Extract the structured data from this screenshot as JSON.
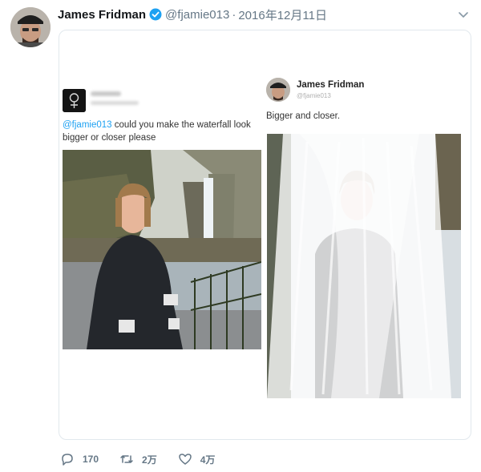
{
  "tweet": {
    "display_name": "James Fridman",
    "handle": "@fjamie013",
    "separator": "·",
    "timestamp": "2016年12月11日",
    "icons": {
      "verified": "verified-badge-icon",
      "menu": "chevron-down-icon"
    }
  },
  "embedded": {
    "left": {
      "mention": "@fjamie013",
      "text": " could you make the waterfall look bigger or closer please"
    },
    "right": {
      "display_name": "James Fridman",
      "handle": "@fjamie013",
      "text": "Bigger and closer."
    }
  },
  "actions": {
    "reply_count": "170",
    "retweet_count": "2万",
    "like_count": "4万"
  },
  "colors": {
    "accent": "#1da1f2",
    "secondary_text": "#657786",
    "border": "#e1e8ed"
  }
}
